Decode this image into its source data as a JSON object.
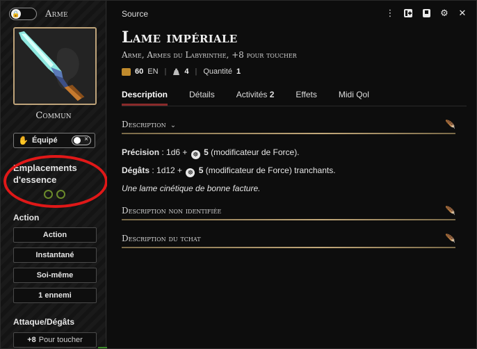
{
  "sidebar": {
    "type_label": "Arme",
    "rarity": "Commun",
    "equip_label": "Équipé",
    "essence_title": "Emplacements d'essence",
    "action_header": "Action",
    "action_items": [
      "Action",
      "Instantané",
      "Soi-même",
      "1 ennemi"
    ],
    "attack_header": "Attaque/Dégâts",
    "attack_bonus": "+8",
    "attack_label": "Pour toucher"
  },
  "header": {
    "source_label": "Source",
    "item_name": "Lame impériale",
    "item_subtitle": "Arme, Armes du Labyrinthe, +8 pour toucher",
    "price_value": "60",
    "price_unit": "EN",
    "weight_value": "4",
    "quantity_label": "Quantité",
    "quantity_value": "1"
  },
  "tabs": [
    {
      "label": "Description",
      "active": true
    },
    {
      "label": "Détails"
    },
    {
      "label": "Activités",
      "count": "2"
    },
    {
      "label": "Effets"
    },
    {
      "label": "Midi Qol"
    }
  ],
  "description": {
    "section_title": "Description",
    "precision_label": "Précision",
    "precision_formula": "1d6 +",
    "precision_mod": "5",
    "precision_note": "(modificateur de Force).",
    "damage_label": "Dégâts",
    "damage_formula": "1d12 +",
    "damage_mod": "5",
    "damage_note": "(modificateur de Force) tranchants.",
    "flavor": "Une lame cinétique de bonne facture.",
    "unidentified_title": "Description non identifiée",
    "chat_title": "Description du tchat"
  },
  "colors": {
    "accent_tab": "#8a2a2a",
    "gold_rule": "#c2a87a",
    "essence_ring": "#6b8a2b",
    "highlight": "#e01818"
  }
}
